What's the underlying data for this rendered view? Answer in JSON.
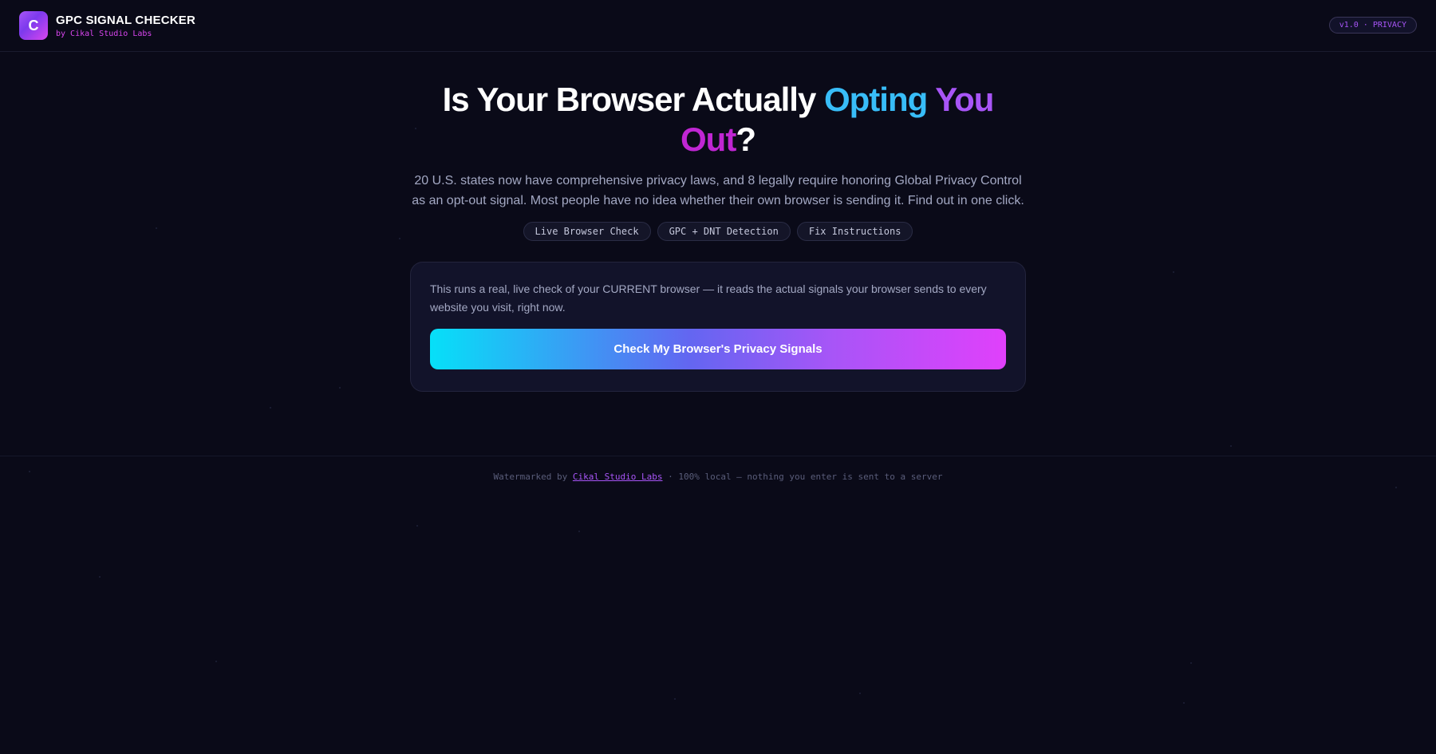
{
  "header": {
    "logo_letter": "C",
    "title": "GPC SIGNAL CHECKER",
    "subtitle": "by Cikal Studio Labs",
    "version_badge": "v1.0 · PRIVACY"
  },
  "hero": {
    "title_part1": "Is Your Browser Actually ",
    "title_word_opting": "Opting",
    "title_word_you": " You",
    "title_word_out": "Out",
    "title_end": "?",
    "description": "20 U.S. states now have comprehensive privacy laws, and 8 legally require honoring Global Privacy Control as an opt-out signal. Most people have no idea whether their own browser is sending it. Find out in one click.",
    "tags": [
      "Live Browser Check",
      "GPC + DNT Detection",
      "Fix Instructions"
    ]
  },
  "card": {
    "text": "This runs a real, live check of your CURRENT browser — it reads the actual signals your browser sends to every website you visit, right now.",
    "button_label": "Check My Browser's Privacy Signals"
  },
  "footer": {
    "prefix": "Watermarked by ",
    "link_label": "Cikal Studio Labs",
    "suffix": " · 100% local — nothing you enter is sent to a server"
  },
  "colors": {
    "background": "#0a0a18",
    "accent_cyan": "#38bdf8",
    "accent_violet": "#a855f7",
    "accent_pink": "#d946ef"
  }
}
